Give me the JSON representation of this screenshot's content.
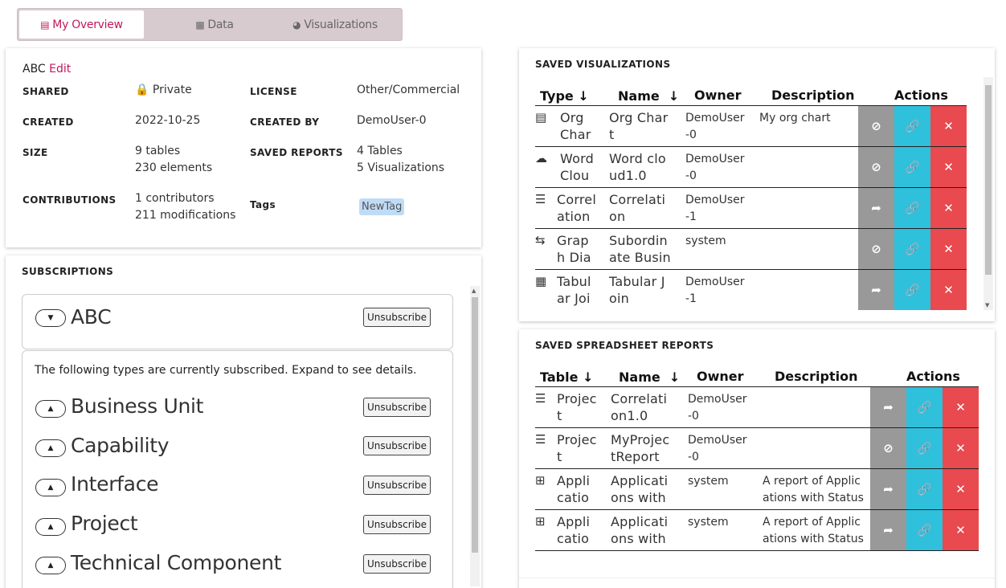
{
  "tabs": [
    {
      "label": "My Overview",
      "icon": "list-icon"
    },
    {
      "label": "Data",
      "icon": "sitemap-icon"
    },
    {
      "label": "Visualizations",
      "icon": "pie-chart-icon"
    }
  ],
  "overview": {
    "name": "ABC",
    "edit": "Edit",
    "shared_label": "SHARED",
    "shared_value": "Private",
    "license_label": "LICENSE",
    "license_value": "Other/Commercial",
    "created_label": "CREATED",
    "created_value": "2022-10-25",
    "created_by_label": "CREATED BY",
    "created_by_value": "DemoUser-0",
    "size_label": "SIZE",
    "size_tables": "9 tables",
    "size_elements": "230 elements",
    "reports_label": "SAVED REPORTS",
    "reports_tables": "4 Tables",
    "reports_vis": "5 Visualizations",
    "contrib_label": "CONTRIBUTIONS",
    "contrib_count": "1 contributors",
    "contrib_mods": "211 modifications",
    "tags_label": "Tags",
    "tag": "NewTag"
  },
  "subscriptions": {
    "title": "SUBSCRIPTIONS",
    "main": {
      "name": "ABC",
      "button": "Unsubscribe"
    },
    "intro": "The following types are currently subscribed. Expand to see details.",
    "types": [
      {
        "name": "Business Unit",
        "button": "Unsubscribe"
      },
      {
        "name": "Capability",
        "button": "Unsubscribe"
      },
      {
        "name": "Interface",
        "button": "Unsubscribe"
      },
      {
        "name": "Project",
        "button": "Unsubscribe"
      },
      {
        "name": "Technical Component",
        "button": "Unsubscribe"
      }
    ]
  },
  "saved_vis": {
    "title": "SAVED VISUALIZATIONS",
    "headers": {
      "type": "Type",
      "name": "Name",
      "owner": "Owner",
      "description": "Description",
      "actions": "Actions"
    },
    "rows": [
      {
        "icon": "org-chart-icon",
        "type1": "Org",
        "type2": "Char",
        "name1": "Org Char",
        "name2": "t",
        "owner1": "DemoUser",
        "owner2": "-0",
        "desc": "My org chart",
        "share": "hidden"
      },
      {
        "icon": "cloud-icon",
        "type1": "Word",
        "type2": "Clou",
        "name1": "Word clo",
        "name2": "ud1.0",
        "owner1": "DemoUser",
        "owner2": "-0",
        "desc": "",
        "share": "hidden"
      },
      {
        "icon": "list-ol-icon",
        "type1": "Correl",
        "type2": "ation",
        "name1": "Correlati",
        "name2": "on",
        "owner1": "DemoUser",
        "owner2": "-1",
        "desc": "",
        "share": "shared"
      },
      {
        "icon": "exchange-icon",
        "type1": "Grap",
        "type2": "h Dia",
        "name1": "Subordin",
        "name2": "ate Busin",
        "owner1": "system",
        "owner2": "",
        "desc": "",
        "share": "hidden"
      },
      {
        "icon": "table-list-icon",
        "type1": "Tabul",
        "type2": "ar Joi",
        "name1": "Tabular J",
        "name2": "oin",
        "owner1": "DemoUser",
        "owner2": "-1",
        "desc": "",
        "share": "shared"
      }
    ]
  },
  "saved_reports": {
    "title": "SAVED SPREADSHEET REPORTS",
    "headers": {
      "table": "Table",
      "name": "Name",
      "owner": "Owner",
      "description": "Description",
      "actions": "Actions"
    },
    "rows": [
      {
        "icon": "tasks-icon",
        "type1": "Projec",
        "type2": "t",
        "name1": "Correlati",
        "name2": "on1.0",
        "owner1": "DemoUser",
        "owner2": "-0",
        "desc1": "",
        "desc2": "",
        "share": "shared"
      },
      {
        "icon": "tasks-icon",
        "type1": "Projec",
        "type2": "t",
        "name1": "MyProjec",
        "name2": "tReport",
        "owner1": "DemoUser",
        "owner2": "-0",
        "desc1": "",
        "desc2": "",
        "share": "hidden"
      },
      {
        "icon": "table-icon",
        "type1": "Appli",
        "type2": "catio",
        "name1": "Applicati",
        "name2": "ons with",
        "owner1": "system",
        "owner2": "",
        "desc1": "A report of Applic",
        "desc2": "ations with Status",
        "share": "shared"
      },
      {
        "icon": "table-icon",
        "type1": "Appli",
        "type2": "catio",
        "name1": "Applicati",
        "name2": "ons with",
        "owner1": "system",
        "owner2": "",
        "desc1": "A report of Applic",
        "desc2": "ations with Status",
        "share": "shared"
      }
    ]
  }
}
